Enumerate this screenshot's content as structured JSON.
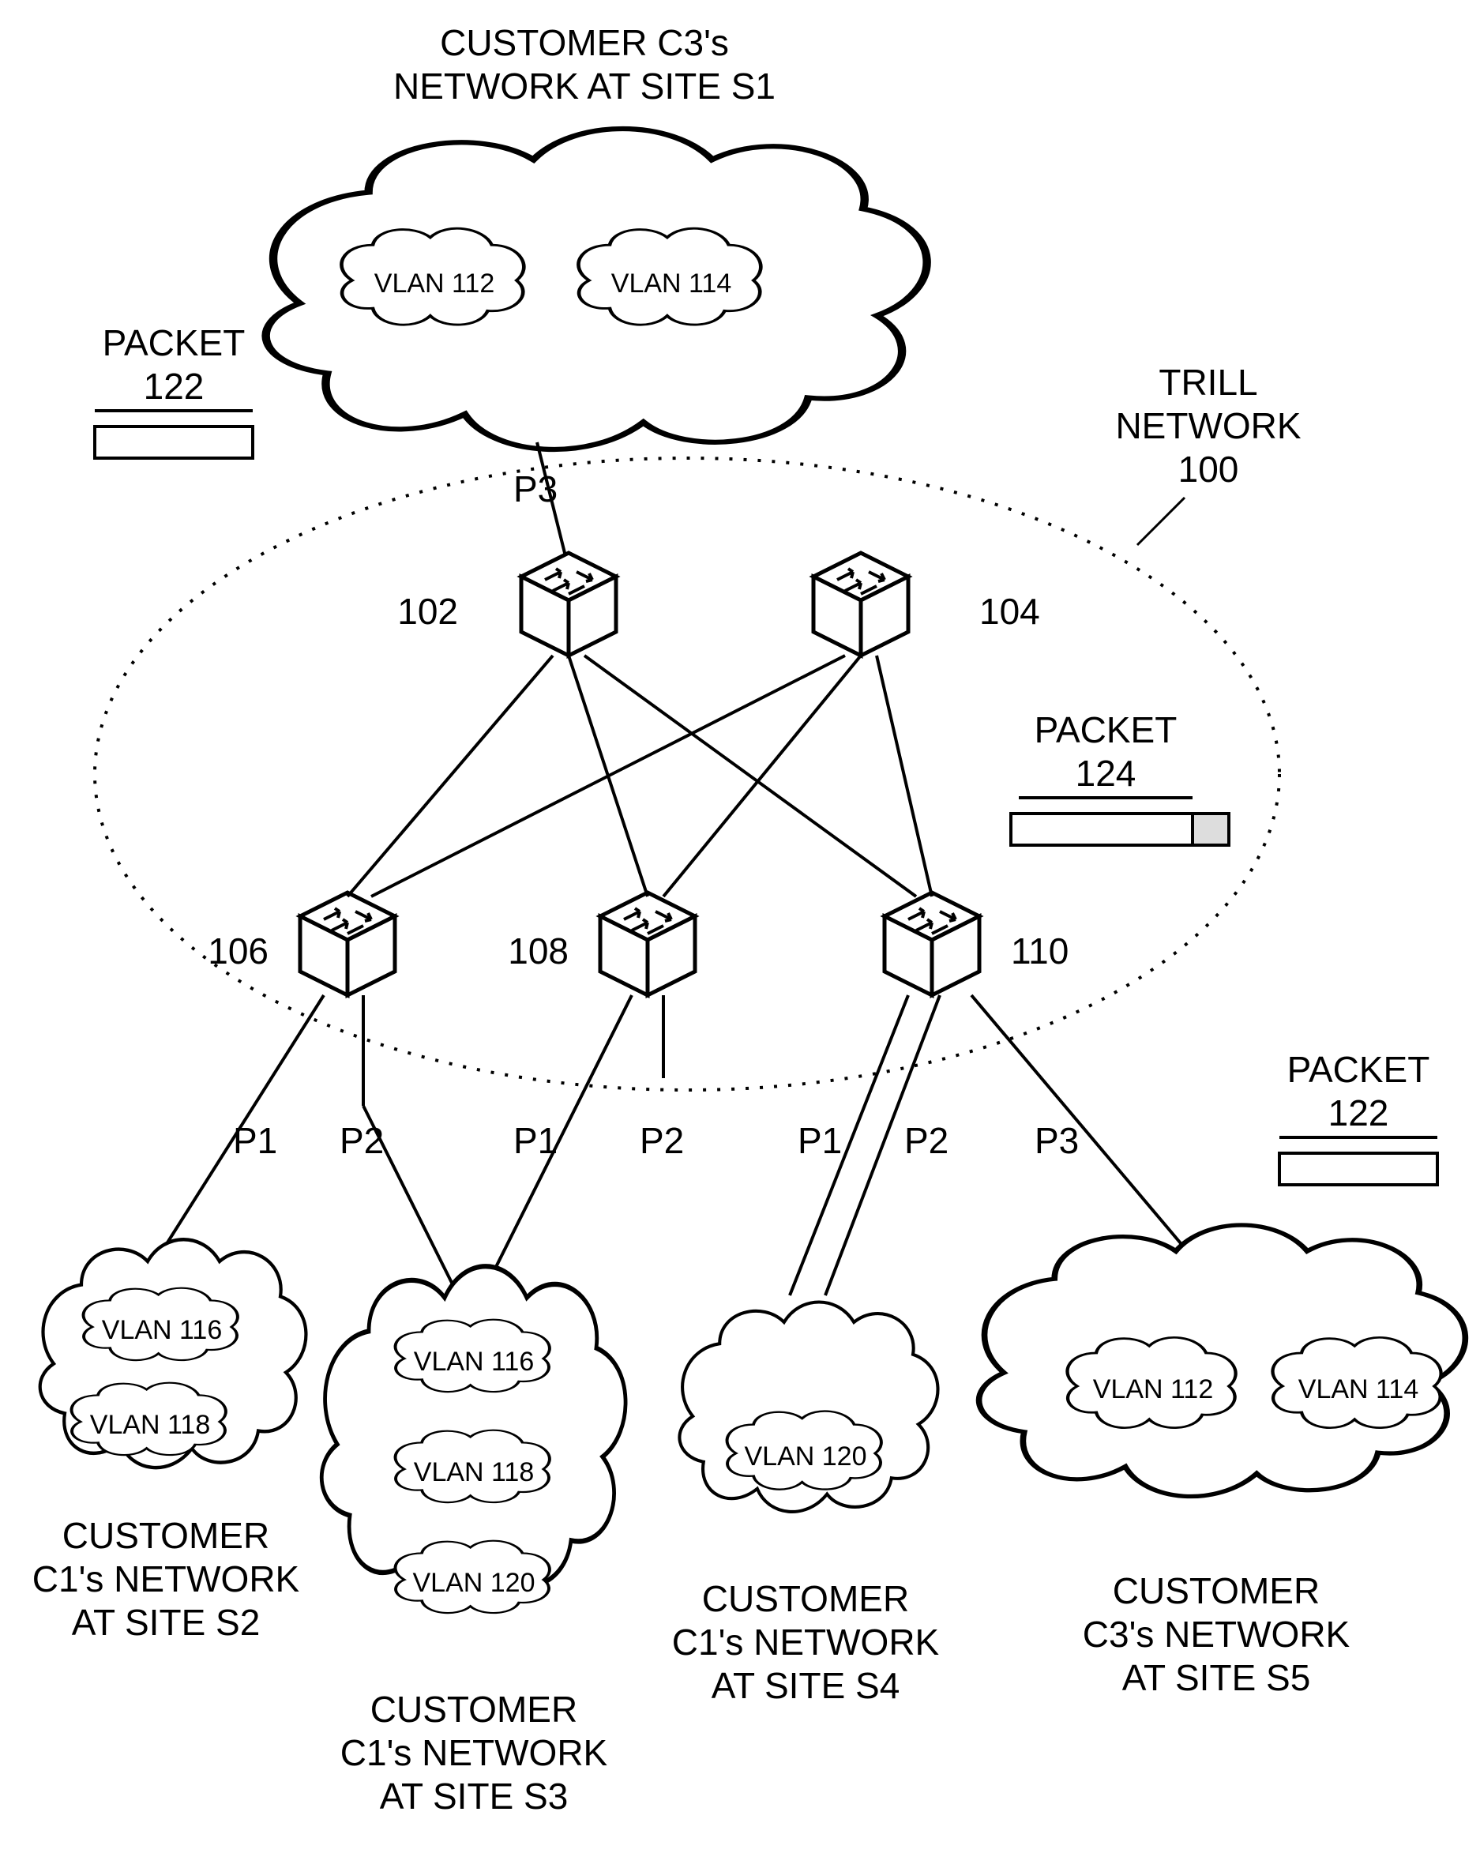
{
  "title_top": {
    "line1": "CUSTOMER C3's",
    "line2": "NETWORK AT SITE S1"
  },
  "trill": {
    "line1": "TRILL",
    "line2": "NETWORK",
    "line3": "100"
  },
  "packet122": {
    "line1": "PACKET",
    "line2": "122"
  },
  "packet124": {
    "line1": "PACKET",
    "line2": "124"
  },
  "packet122b": {
    "line1": "PACKET",
    "line2": "122"
  },
  "router102": "102",
  "router104": "104",
  "router106": "106",
  "router108": "108",
  "router110": "110",
  "port_p3_top": "P3",
  "ports_bottom": {
    "p1a": "P1",
    "p2a": "P2",
    "p1b": "P1",
    "p2b": "P2",
    "p1c": "P1",
    "p2c": "P2",
    "p3c": "P3"
  },
  "cloud_c1_s2": {
    "l1": "CUSTOMER",
    "l2": "C1's NETWORK",
    "l3": "AT SITE S2"
  },
  "cloud_c1_s3": {
    "l1": "CUSTOMER",
    "l2": "C1's NETWORK",
    "l3": "AT SITE S3"
  },
  "cloud_c1_s4": {
    "l1": "CUSTOMER",
    "l2": "C1's NETWORK",
    "l3": "AT SITE S4"
  },
  "cloud_c3_s5": {
    "l1": "CUSTOMER",
    "l2": "C3's NETWORK",
    "l3": "AT SITE S5"
  },
  "vlan112": "VLAN 112",
  "vlan114": "VLAN 114",
  "vlan116": "VLAN 116",
  "vlan118": "VLAN 118",
  "vlan120": "VLAN 120"
}
